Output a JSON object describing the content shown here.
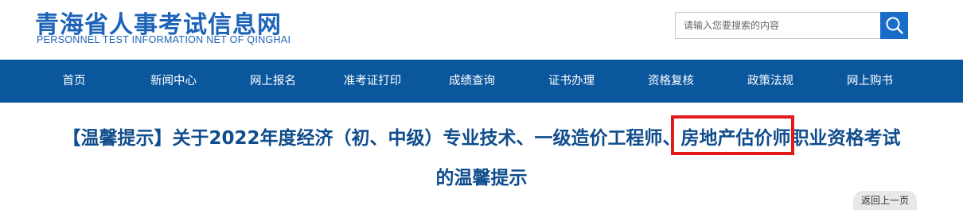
{
  "header": {
    "site_title": "青海省人事考试信息网",
    "site_subtitle": "PERSONNEL TEST INFORMATION NET OF QINGHAI"
  },
  "search": {
    "placeholder": "请输入您要搜索的内容",
    "icon": "search-icon"
  },
  "nav": {
    "items": [
      {
        "label": "首页"
      },
      {
        "label": "新闻中心"
      },
      {
        "label": "网上报名"
      },
      {
        "label": "准考证打印"
      },
      {
        "label": "成绩查询"
      },
      {
        "label": "证书办理"
      },
      {
        "label": "资格复核"
      },
      {
        "label": "政策法规"
      },
      {
        "label": "网上购书"
      }
    ]
  },
  "article": {
    "title_line1": "【温馨提示】关于2022年度经济（初、中级）专业技术、一级造价工程师、房地产估价师职业资格考试",
    "title_line2": "的温馨提示"
  },
  "back_label": "返回上一页",
  "colors": {
    "brand_blue": "#1c63b8",
    "nav_bg": "#0b579d",
    "title_blue": "#0f4c8c",
    "search_btn": "#1a6cc9",
    "highlight_red": "#e21a1a"
  }
}
